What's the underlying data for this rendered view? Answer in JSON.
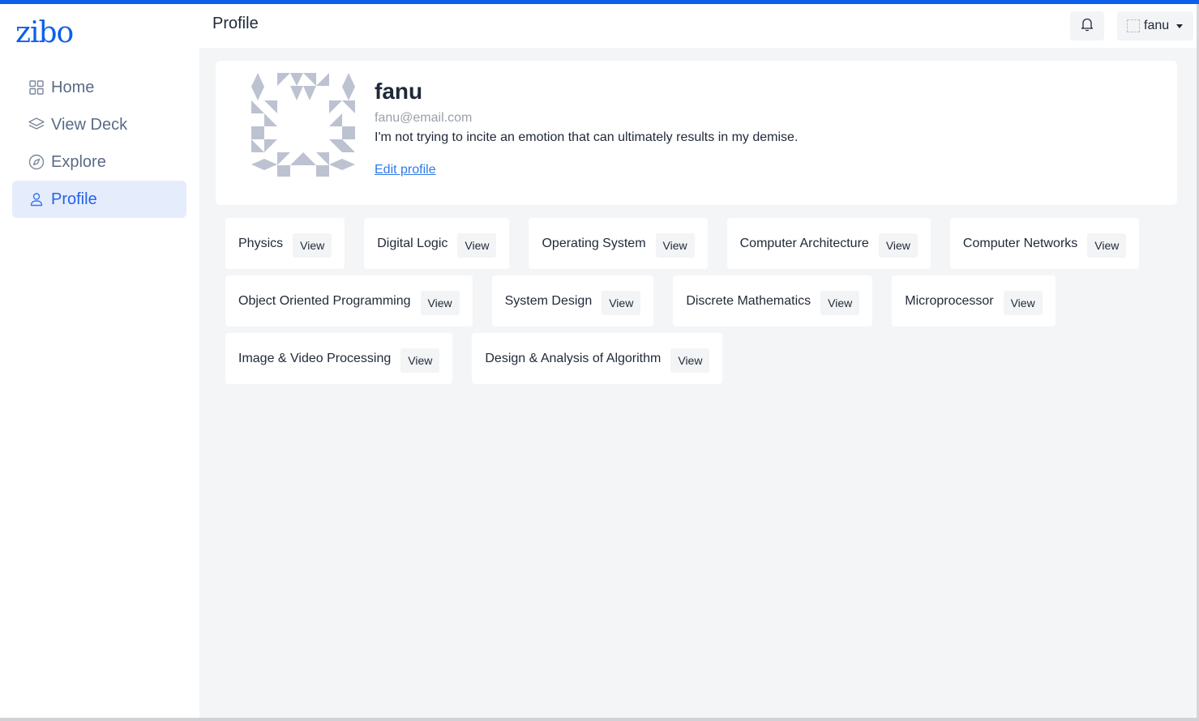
{
  "sidebar": {
    "logo": "zibo",
    "items": [
      {
        "label": "Home",
        "icon": "grid-icon"
      },
      {
        "label": "View Deck",
        "icon": "layers-icon"
      },
      {
        "label": "Explore",
        "icon": "compass-icon"
      },
      {
        "label": "Profile",
        "icon": "user-icon",
        "active": true
      }
    ]
  },
  "header": {
    "title": "Profile",
    "user_name": "fanu"
  },
  "profile": {
    "name": "fanu",
    "email": "fanu@email.com",
    "bio": "I'm not trying to incite an emotion that can ultimately results in my demise.",
    "edit_label": "Edit profile"
  },
  "decks": [
    {
      "name": "Physics",
      "action": "View"
    },
    {
      "name": "Digital Logic",
      "action": "View"
    },
    {
      "name": "Operating System",
      "action": "View"
    },
    {
      "name": "Computer Architecture",
      "action": "View"
    },
    {
      "name": "Computer Networks",
      "action": "View"
    },
    {
      "name": "Object Oriented Programming",
      "action": "View"
    },
    {
      "name": "System Design",
      "action": "View"
    },
    {
      "name": "Discrete Mathematics",
      "action": "View"
    },
    {
      "name": "Microprocessor",
      "action": "View"
    },
    {
      "name": "Image & Video Processing",
      "action": "View"
    },
    {
      "name": "Design & Analysis of Algorithm",
      "action": "View"
    }
  ],
  "colors": {
    "accent": "#0d5fe9",
    "active_bg": "#e5edfd",
    "link": "#2f7ae5",
    "page_bg": "#f4f5f7"
  }
}
